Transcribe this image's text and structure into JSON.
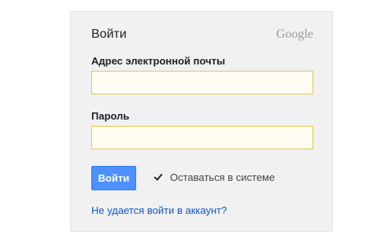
{
  "form": {
    "title": "Войти",
    "brand_logo": "Google",
    "email_label": "Адрес электронной почты",
    "email_value": "",
    "password_label": "Пароль",
    "password_value": "",
    "signin_label": "Войти",
    "stay_signed_in_label": "Оставаться в системе",
    "stay_signed_in_checked": true,
    "help_link": "Не удается войти в аккаунт?"
  },
  "colors": {
    "card_background": "#f1f1f1",
    "field_border": "#e8c54a",
    "button_blue": "#4d90fe",
    "link_blue": "#1155cc"
  }
}
